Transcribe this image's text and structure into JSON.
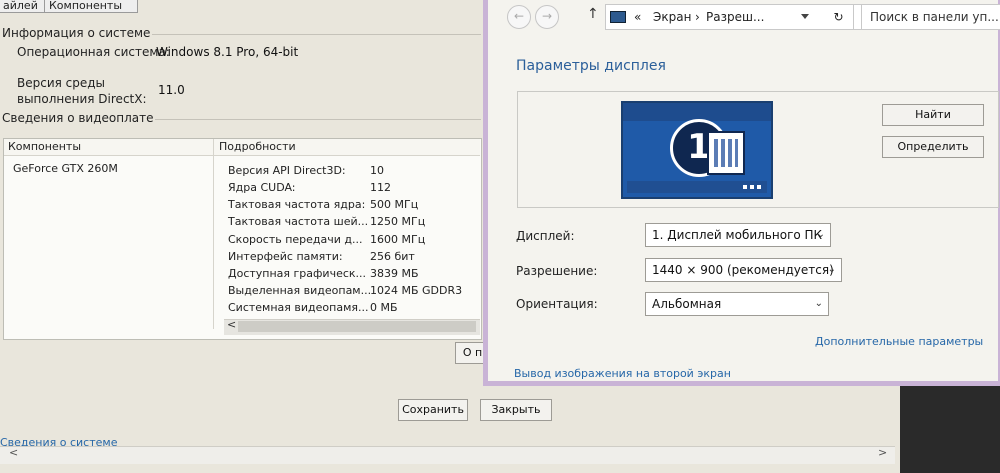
{
  "tabs": [
    "айлей",
    "Компоненты"
  ],
  "system_info": {
    "title": "Информация о системе",
    "os_label": "Операционная система:",
    "os_value": "Windows 8.1 Pro, 64-bit",
    "dx_label_1": "Версия среды",
    "dx_label_2": "выполнения DirectX:",
    "dx_value": "11.0"
  },
  "video_info": {
    "title": "Сведения о видеоплате",
    "col_components": "Компоненты",
    "col_details": "Подробности",
    "component": "GeForce GTX 260M",
    "rows": [
      {
        "label": "Версия API Direct3D:",
        "value": "10"
      },
      {
        "label": "Ядра CUDA:",
        "value": "112"
      },
      {
        "label": "Тактовая частота ядра:",
        "value": "500 МГц"
      },
      {
        "label": "Тактовая частота шей...",
        "value": "1250 МГц"
      },
      {
        "label": "Скорость передачи д...",
        "value": "1600 МГц"
      },
      {
        "label": "Интерфейс памяти:",
        "value": "256 бит"
      },
      {
        "label": "Доступная графическ...",
        "value": "3839 МБ"
      },
      {
        "label": "Выделенная видеопам...",
        "value": "1024 МБ GDDR3"
      },
      {
        "label": "Системная видеопамя...",
        "value": "0 МБ"
      }
    ],
    "scroll_left": "<",
    "about_btn": "О пр"
  },
  "bottom": {
    "save": "Сохранить",
    "close": "Закрыть",
    "link": "Сведения о системе",
    "scroll_left": "<",
    "scroll_right": ">"
  },
  "explorer": {
    "back": "←",
    "forward": "→",
    "up": "↑",
    "crumb_prefix": "«",
    "crumb_1": "Экран",
    "crumb_sep": "›",
    "crumb_2": "Разреш...",
    "refresh": "↻",
    "search_placeholder": "Поиск в панели уп...",
    "page_title": "Параметры дисплея",
    "monitor_number": "1",
    "find_btn": "Найти",
    "identify_btn": "Определить",
    "display_label": "Дисплей:",
    "display_value": "1. Дисплей мобильного ПК",
    "resolution_label": "Разрешение:",
    "resolution_value": "1440 × 900 (рекомендуется)",
    "orientation_label": "Ориентация:",
    "orientation_value": "Альбомная",
    "advanced_link": "Дополнительные параметры",
    "second_screen_link": "Вывод изображения на второй экран"
  },
  "colors": {
    "accent_link": "#2667a8",
    "title_blue": "#3b6aa0",
    "monitor_blue": "#3b72b8",
    "window_border": "#c9b3d6"
  }
}
